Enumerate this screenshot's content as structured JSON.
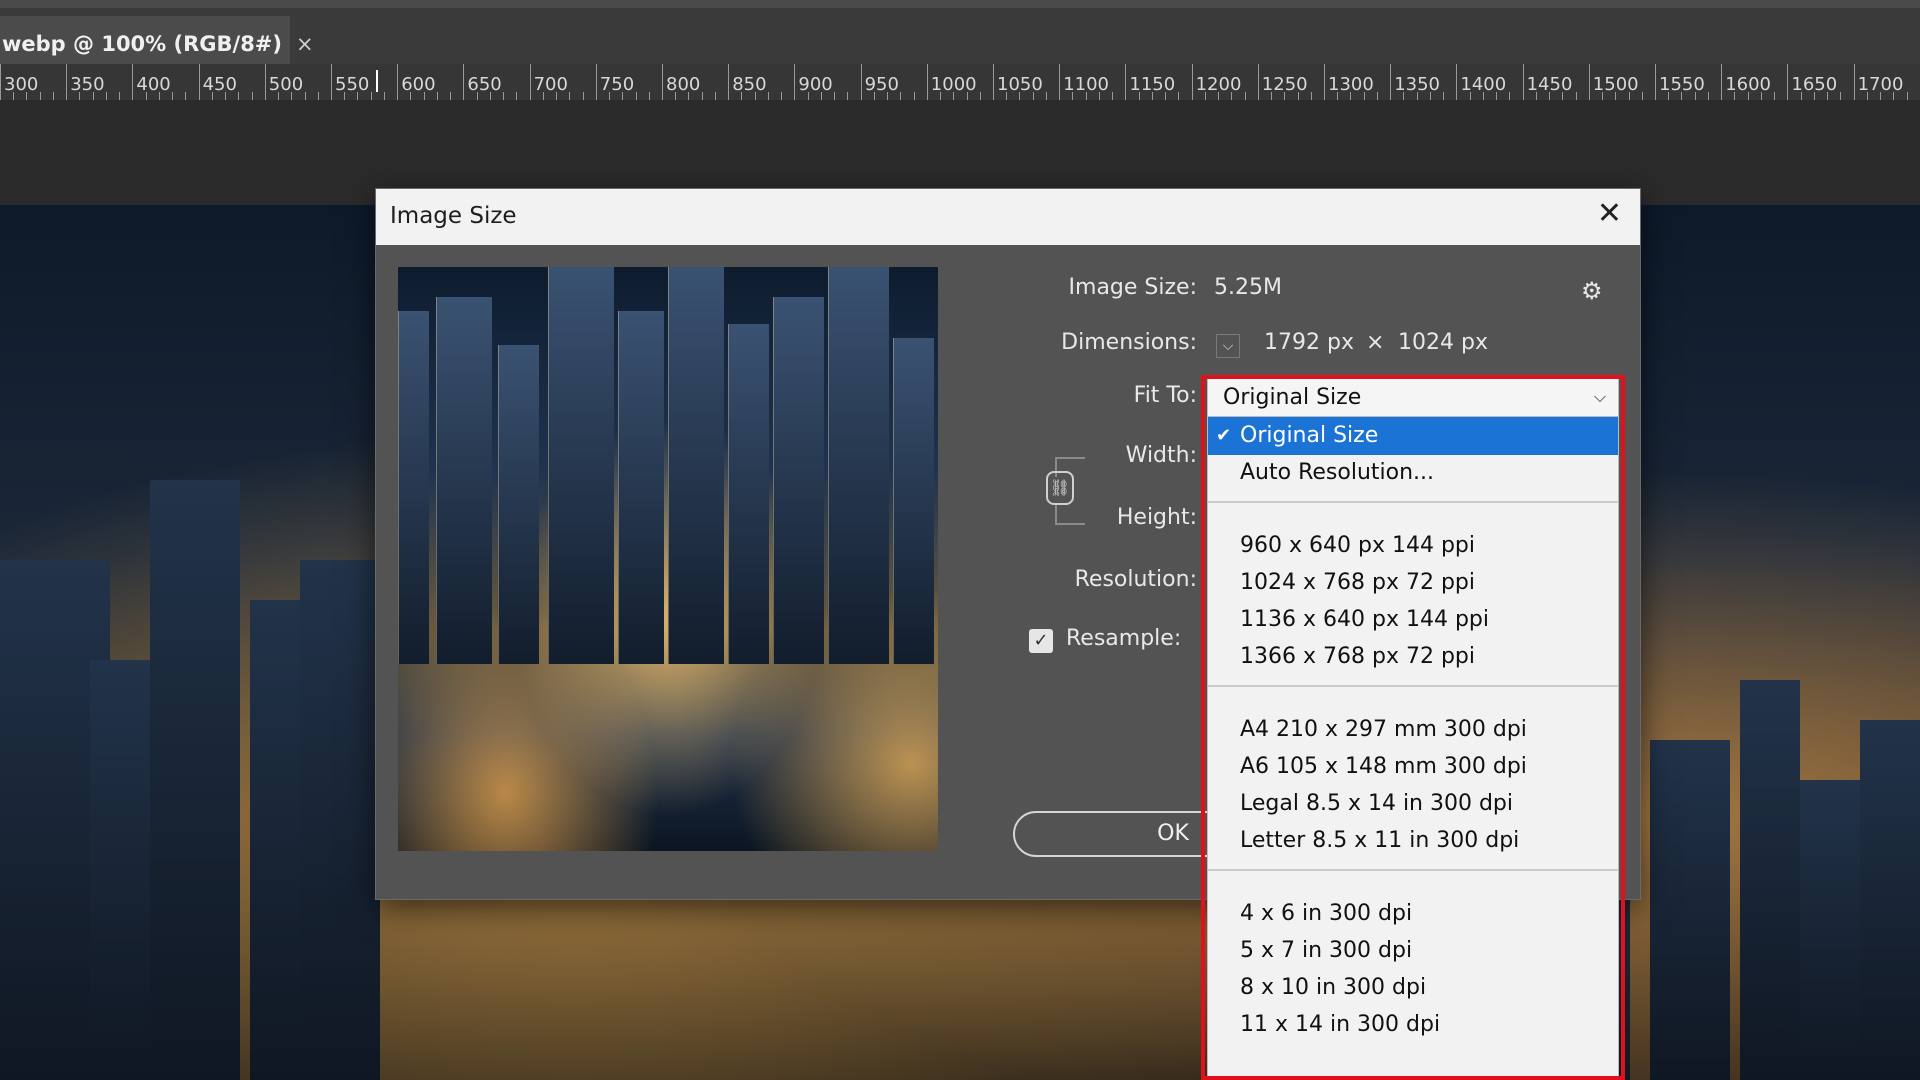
{
  "document_tab": {
    "title": "webp @ 100% (RGB/8#)",
    "close_glyph": "×"
  },
  "ruler": {
    "labels": [
      "300",
      "350",
      "400",
      "450",
      "500",
      "550",
      "600",
      "650",
      "700",
      "750",
      "800",
      "850",
      "900",
      "950",
      "1000",
      "1050",
      "1100",
      "1150",
      "1200",
      "1250",
      "1300",
      "1350",
      "1400",
      "1450",
      "1500",
      "1550",
      "1600",
      "1650",
      "1700"
    ]
  },
  "dialog": {
    "title": "Image Size",
    "close_glyph": "✕",
    "image_size_label": "Image Size:",
    "image_size_value": "5.25M",
    "dimensions_label": "Dimensions:",
    "width_value": "1792 px",
    "times_glyph": "×",
    "height_value": "1024 px",
    "fit_to_label": "Fit To:",
    "width_label": "Width:",
    "height_label": "Height:",
    "resolution_label": "Resolution:",
    "resample_label": "Resample:",
    "resample_checked": true,
    "ok_label": "OK",
    "gear_glyph": "⚙"
  },
  "fit_to_dropdown": {
    "selected": "Original Size",
    "chevron": "⌵",
    "groups": [
      [
        "Original Size",
        "Auto Resolution..."
      ],
      [
        "960 x 640 px 144 ppi",
        "1024 x 768 px 72 ppi",
        "1136 x 640 px 144 ppi",
        "1366 x 768 px 72 ppi"
      ],
      [
        "A4 210 x 297 mm 300 dpi",
        "A6 105 x 148 mm 300 dpi",
        "Legal 8.5 x 14 in 300 dpi",
        "Letter 8.5 x 11 in 300 dpi"
      ],
      [
        "4 x 6 in 300 dpi",
        "5 x 7 in 300 dpi",
        "8 x 10 in 300 dpi",
        "11 x 14 in 300 dpi"
      ]
    ]
  },
  "colors": {
    "selection": "#1c73d6",
    "highlight_border": "#e0111a",
    "dialog_bg": "#535353"
  },
  "icons": {
    "settings": "gear-icon",
    "close": "close-icon",
    "link": "chain-link-icon",
    "check": "checkmark-icon"
  }
}
